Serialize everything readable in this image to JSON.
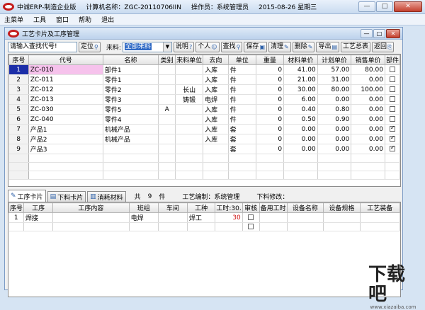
{
  "window": {
    "app_title": "中诚ERP-制造企业版",
    "computer_label": "计算机名称：ZGC-20110706IIN",
    "operator_label": "操作员：系统管理员",
    "date_label": "2015-08-26 星期三",
    "min": "—",
    "max": "□",
    "close": "✕"
  },
  "menu": [
    "主菜单",
    "工具",
    "窗口",
    "帮助",
    "退出"
  ],
  "child": {
    "title": "工艺卡片及工序管理",
    "min": "—",
    "max": "□",
    "close": "✕"
  },
  "toolbar": {
    "search_value": "请输入查找代号!",
    "locate": "定位",
    "source_label": "来料:",
    "source_value": "全部来料",
    "buttons": [
      "说明",
      "个人",
      "查找",
      "保存",
      "清理",
      "删除",
      "导出",
      "工艺总表",
      "返回"
    ]
  },
  "grid": {
    "headers": [
      "序号",
      "代号",
      "名称",
      "类别",
      "来料单位",
      "去向",
      "单位",
      "重量",
      "材料单价",
      "计划单价",
      "销售单价",
      "部件"
    ],
    "rows": [
      [
        "1",
        "ZC-010",
        "部件1",
        "",
        "",
        "入库",
        "件",
        "0",
        "41.00",
        "57.00",
        "80.00",
        "off"
      ],
      [
        "2",
        "ZC-011",
        "零件1",
        "",
        "",
        "入库",
        "件",
        "0",
        "21.00",
        "31.00",
        "0.00",
        "off"
      ],
      [
        "3",
        "ZC-012",
        "零件2",
        "",
        "长山",
        "入库",
        "件",
        "0",
        "30.00",
        "80.00",
        "100.00",
        "off"
      ],
      [
        "4",
        "ZC-013",
        "零件3",
        "",
        "铸锻",
        "电焊",
        "件",
        "0",
        "6.00",
        "0.00",
        "0.00",
        "off"
      ],
      [
        "5",
        "ZC-030",
        "零件5",
        "A",
        "",
        "入库",
        "件",
        "0",
        "0.40",
        "0.80",
        "0.00",
        "off"
      ],
      [
        "6",
        "ZC-040",
        "零件4",
        "",
        "",
        "入库",
        "件",
        "0",
        "0.50",
        "0.90",
        "0.00",
        "off"
      ],
      [
        "7",
        "产品1",
        "机械产品",
        "",
        "",
        "入库",
        "套",
        "0",
        "0.00",
        "0.00",
        "0.00",
        "on"
      ],
      [
        "8",
        "产品2",
        "机械产品",
        "",
        "",
        "入库",
        "套",
        "0",
        "0.00",
        "0.00",
        "0.00",
        "on"
      ],
      [
        "9",
        "产品3",
        "",
        "",
        "",
        "",
        "套",
        "0",
        "0.00",
        "0.00",
        "0.00",
        "on"
      ]
    ]
  },
  "tabs": [
    "工序卡片",
    "下料卡片",
    "消耗材料"
  ],
  "info": {
    "count_prefix": "共",
    "count": "9",
    "count_unit": "件",
    "editor": "工艺编制：系统管理",
    "cut_label": "下料修改："
  },
  "grid2": {
    "headers": [
      "序号",
      "工序",
      "工序内容",
      "班组",
      "车间",
      "工种",
      "工时:30.",
      "审核",
      "备用工时",
      "设备名称",
      "设备规格",
      "工艺装备"
    ],
    "rows": [
      [
        "1",
        "焊接",
        "",
        "电焊",
        "",
        "焊工",
        "30",
        "off",
        "",
        "",
        "",
        ""
      ],
      [
        "",
        "",
        "",
        "",
        "",
        "",
        "",
        "off",
        "",
        "",
        "",
        ""
      ]
    ]
  },
  "watermark": {
    "text": "下载吧",
    "url": "www.xiazaiba.com"
  }
}
